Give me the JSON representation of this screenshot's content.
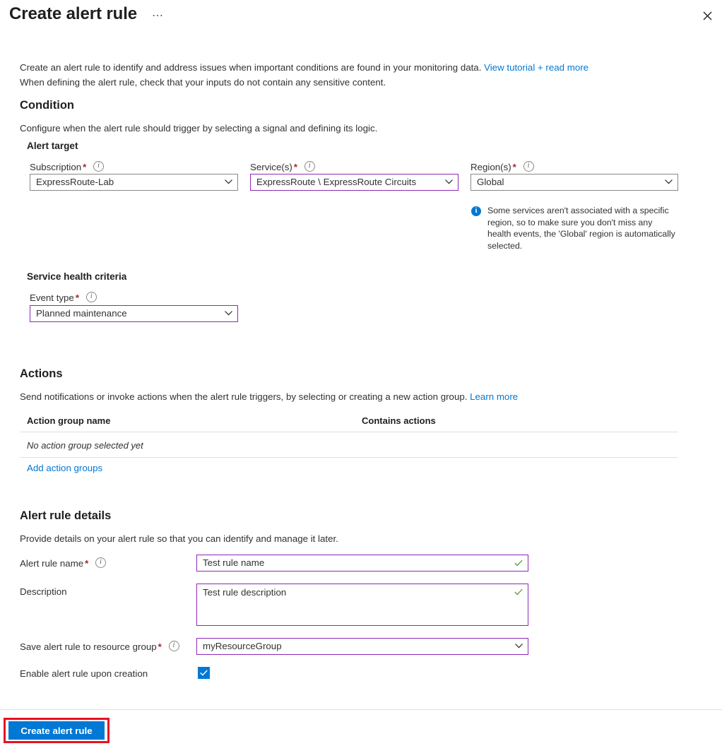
{
  "header": {
    "title": "Create alert rule",
    "ellipsis_label": "⋯",
    "close_icon": "close-icon"
  },
  "intro": {
    "line1_before_link": "Create an alert rule to identify and address issues when important conditions are found in your monitoring data. ",
    "line1_link": "View tutorial + read more",
    "line2": "When defining the alert rule, check that your inputs do not contain any sensitive content."
  },
  "condition": {
    "heading": "Condition",
    "subtitle": "Configure when the alert rule should trigger by selecting a signal and defining its logic.",
    "alert_target_heading": "Alert target",
    "subscription": {
      "label": "Subscription",
      "required": "*",
      "value": "ExpressRoute-Lab"
    },
    "services": {
      "label": "Service(s)",
      "required": "*",
      "value": "ExpressRoute \\ ExpressRoute Circuits"
    },
    "regions": {
      "label": "Region(s)",
      "required": "*",
      "value": "Global"
    },
    "region_callout": "Some services aren't associated with a specific region, so to make sure you don't miss any health events, the 'Global' region is automatically selected."
  },
  "service_health": {
    "heading": "Service health criteria",
    "event_type": {
      "label": "Event type",
      "required": "*",
      "value": "Planned maintenance"
    }
  },
  "actions": {
    "heading": "Actions",
    "subtitle_before_link": "Send notifications or invoke actions when the alert rule triggers, by selecting or creating a new action group. ",
    "subtitle_link": "Learn more",
    "col_name": "Action group name",
    "col_contains": "Contains actions",
    "empty_text": "No action group selected yet",
    "add_link": "Add action groups"
  },
  "alert_rule_details": {
    "heading": "Alert rule details",
    "subtitle": "Provide details on your alert rule so that you can identify and manage it later.",
    "rule_name": {
      "label": "Alert rule name",
      "required": "*",
      "value": "Test rule name"
    },
    "description": {
      "label": "Description",
      "value": "Test rule description"
    },
    "resource_group": {
      "label": "Save alert rule to resource group",
      "required": "*",
      "value": "myResourceGroup"
    },
    "enable_checkbox": {
      "label": "Enable alert rule upon creation",
      "checked": true
    }
  },
  "footer": {
    "create_button": "Create alert rule"
  },
  "colors": {
    "accent_blue": "#0078d4",
    "focus_purple": "#8c29b5",
    "required_red": "#a4262c",
    "highlight_red": "#e81123",
    "valid_green": "#5a9e2f"
  }
}
